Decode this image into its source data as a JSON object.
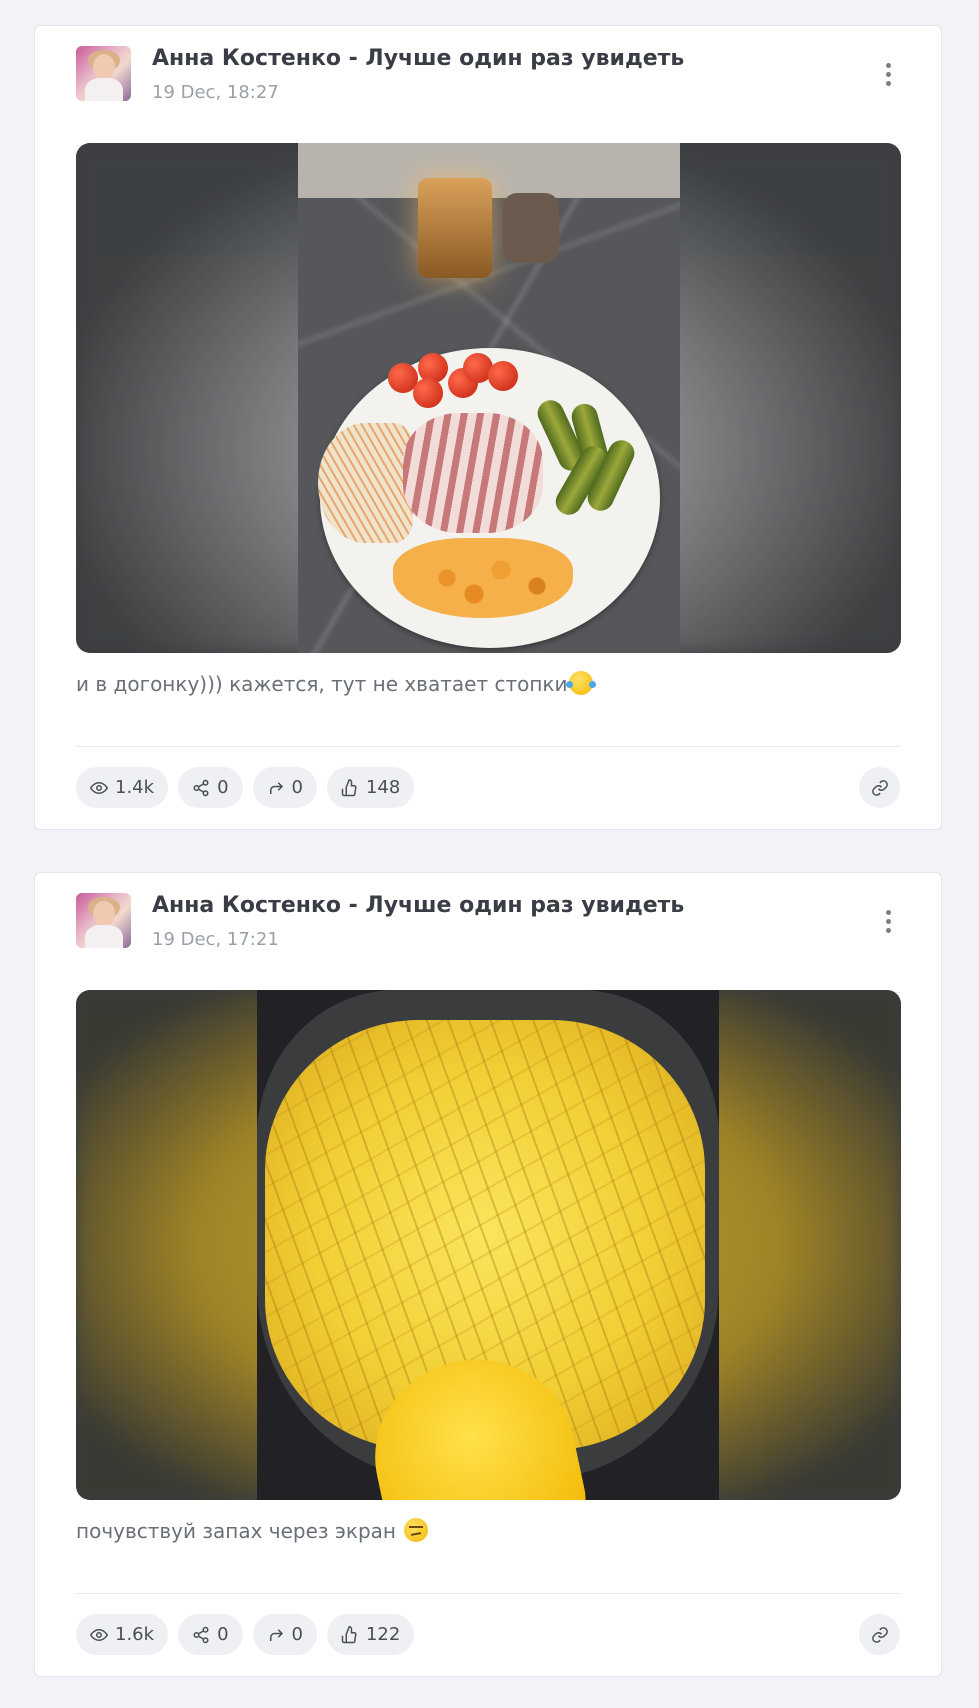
{
  "posts": [
    {
      "author": "Анна Костенко - Лучше один раз увидеть",
      "date": "19 Dec, 18:27",
      "caption": "и в догонку))) кажется, тут не хватает стопки",
      "caption_emoji": "tears-of-joy",
      "stats": {
        "views": "1.4k",
        "shares": "0",
        "reposts": "0",
        "likes": "148"
      }
    },
    {
      "author": "Анна Костенко - Лучше один раз увидеть",
      "date": "19 Dec, 17:21",
      "caption": "почувствуй запах через экран ",
      "caption_emoji": "relieved-face",
      "stats": {
        "views": "1.6k",
        "shares": "0",
        "reposts": "0",
        "likes": "122"
      }
    }
  ],
  "icons": {
    "views": "eye-icon",
    "shares": "share-icon",
    "reposts": "repost-arrow-icon",
    "likes": "thumbs-up-icon",
    "link": "link-icon",
    "menu": "more-vertical-icon"
  },
  "colors": {
    "page_bg": "#f1f3f7",
    "card_bg": "#ffffff",
    "pill_bg": "#eef0f4",
    "author_text": "#3a3d45",
    "muted_text": "#9aa0aa"
  }
}
